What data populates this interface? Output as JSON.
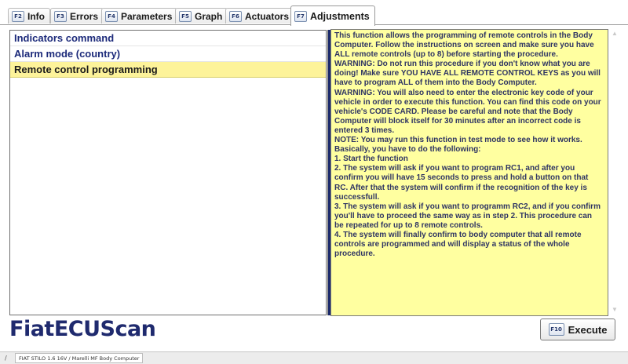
{
  "tabs": [
    {
      "key": "F2",
      "label": "Info"
    },
    {
      "key": "F3",
      "label": "Errors"
    },
    {
      "key": "F4",
      "label": "Parameters"
    },
    {
      "key": "F5",
      "label": "Graph"
    },
    {
      "key": "F6",
      "label": "Actuators"
    },
    {
      "key": "F7",
      "label": "Adjustments"
    }
  ],
  "active_tab": "Adjustments",
  "functions": [
    {
      "label": "Indicators command"
    },
    {
      "label": "Alarm mode (country)"
    },
    {
      "label": "Remote control programming"
    }
  ],
  "selected_function": "Remote control programming",
  "description": "This function allows the programming of remote controls in the Body Computer. Follow the instructions on screen and make sure you have ALL remote controls (up to 8) before starting the procedure.\nWARNING: Do not run this procedure if you don't know what you are doing! Make sure YOU HAVE ALL REMOTE CONTROL KEYS as you will have to program ALL of them into the Body Computer.\nWARNING: You will also need to enter the electronic key code of your vehicle in order to execute this function. You can find this code on your vehicle's CODE CARD. Please be careful and note that the Body Computer will block itself for 30 minutes after an incorrect code is entered 3 times.\nNOTE: You may run this function in test mode to see how it works.\nBasically, you have to do the following:\n1. Start the function\n2. The system will ask if you want to program RC1, and after you confirm you will have 15 seconds to press and hold a button on that RC. After that the system will confirm if the recognition of the key is successfull.\n3. The system will ask if you want to programm RC2, and if you confirm you'll have to proceed the same way as in step 2. This procedure can be repeated for up to 8 remote controls.\n4. The system will finally confirm to body computer that all remote controls are programmed and will display a status of the whole procedure.",
  "logo": "FiatECUScan",
  "execute": {
    "key": "F10",
    "label": "Execute"
  },
  "status": {
    "icon": "/",
    "text": "FIAT STILO 1.6 16V / Marelli MF Body Computer"
  },
  "colors": {
    "selection": "#fdf39a",
    "description_bg": "#ffffa0",
    "accent": "#1f2a6e"
  }
}
